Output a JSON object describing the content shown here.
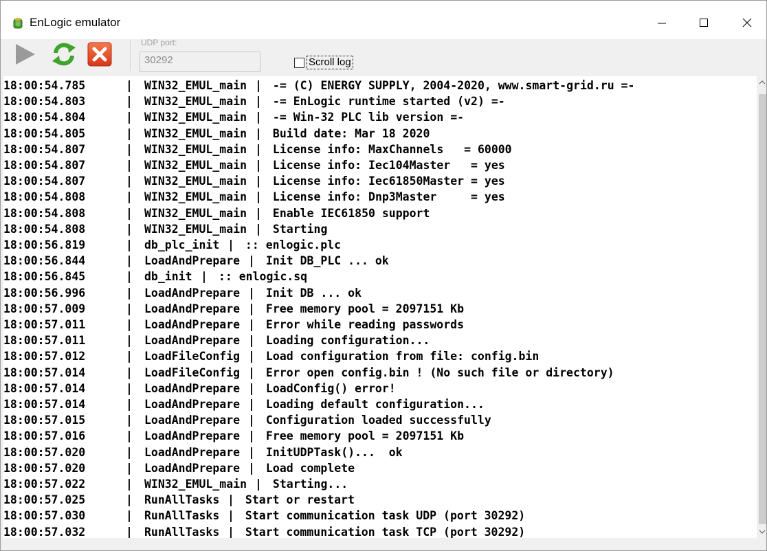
{
  "window": {
    "title": "EnLogic emulator",
    "controls": [
      "minimize",
      "maximize",
      "close"
    ]
  },
  "toolbar": {
    "buttons": [
      {
        "name": "start",
        "icon": "play-icon",
        "color": "#909090"
      },
      {
        "name": "restart",
        "icon": "refresh-icon",
        "color": "#3ea52c"
      },
      {
        "name": "stop",
        "icon": "close-square-icon",
        "color": "#e34b1e"
      }
    ],
    "udp_label": "UDP port:",
    "udp_value": "30292",
    "scroll_log_label": "Scroll log",
    "scroll_log_checked": false
  },
  "log": [
    {
      "time": "18:00:54.785",
      "source": "WIN32_EMUL_main",
      "message": " -= (C) ENERGY SUPPLY, 2004-2020, www.smart-grid.ru =-"
    },
    {
      "time": "18:00:54.803",
      "source": "WIN32_EMUL_main",
      "message": " -= EnLogic runtime started (v2) =-"
    },
    {
      "time": "18:00:54.804",
      "source": "WIN32_EMUL_main",
      "message": " -= Win-32 PLC lib version =-"
    },
    {
      "time": "18:00:54.805",
      "source": "WIN32_EMUL_main",
      "message": " Build date: Mar 18 2020"
    },
    {
      "time": "18:00:54.807",
      "source": "WIN32_EMUL_main",
      "message": " License info: MaxChannels   = 60000"
    },
    {
      "time": "18:00:54.807",
      "source": "WIN32_EMUL_main",
      "message": " License info: Iec104Master   = yes"
    },
    {
      "time": "18:00:54.807",
      "source": "WIN32_EMUL_main",
      "message": " License info: Iec61850Master = yes"
    },
    {
      "time": "18:00:54.808",
      "source": "WIN32_EMUL_main",
      "message": " License info: Dnp3Master     = yes"
    },
    {
      "time": "18:00:54.808",
      "source": "WIN32_EMUL_main",
      "message": " Enable IEC61850 support"
    },
    {
      "time": "18:00:54.808",
      "source": "WIN32_EMUL_main",
      "message": " Starting"
    },
    {
      "time": "18:00:56.819",
      "source": "db_plc_init",
      "message": " :: enlogic.plc"
    },
    {
      "time": "18:00:56.844",
      "source": "LoadAndPrepare",
      "message": " Init DB_PLC ... ok"
    },
    {
      "time": "18:00:56.845",
      "source": "db_init",
      "message": " :: enlogic.sq"
    },
    {
      "time": "18:00:56.996",
      "source": "LoadAndPrepare",
      "message": " Init DB ... ok"
    },
    {
      "time": "18:00:57.009",
      "source": "LoadAndPrepare",
      "message": " Free memory pool = 2097151 Kb"
    },
    {
      "time": "18:00:57.011",
      "source": "LoadAndPrepare",
      "message": " Error while reading passwords"
    },
    {
      "time": "18:00:57.011",
      "source": "LoadAndPrepare",
      "message": " Loading configuration..."
    },
    {
      "time": "18:00:57.012",
      "source": "LoadFileConfig",
      "message": " Load configuration from file: config.bin"
    },
    {
      "time": "18:00:57.014",
      "source": "LoadFileConfig",
      "message": " Error open config.bin ! (No such file or directory)"
    },
    {
      "time": "18:00:57.014",
      "source": "LoadAndPrepare",
      "message": " LoadConfig() error!"
    },
    {
      "time": "18:00:57.014",
      "source": "LoadAndPrepare",
      "message": " Loading default configuration..."
    },
    {
      "time": "18:00:57.015",
      "source": "LoadAndPrepare",
      "message": " Configuration loaded successfully"
    },
    {
      "time": "18:00:57.016",
      "source": "LoadAndPrepare",
      "message": " Free memory pool = 2097151 Kb"
    },
    {
      "time": "18:00:57.020",
      "source": "LoadAndPrepare",
      "message": " InitUDPTask()...  ok"
    },
    {
      "time": "18:00:57.020",
      "source": "LoadAndPrepare",
      "message": " Load complete"
    },
    {
      "time": "18:00:57.022",
      "source": "WIN32_EMUL_main",
      "message": " Starting..."
    },
    {
      "time": "18:00:57.025",
      "source": "RunAllTasks",
      "message": " Start or restart"
    },
    {
      "time": "18:00:57.030",
      "source": "RunAllTasks",
      "message": " Start communication task UDP (port 30292)"
    },
    {
      "time": "18:00:57.032",
      "source": "RunAllTasks",
      "message": " Start communication task TCP (port 30292)"
    }
  ],
  "log_separator": "|",
  "icons": {
    "app": "enlogic-app-icon",
    "scroll_up": "chevron-up-icon",
    "scroll_down": "chevron-down-icon"
  },
  "colors": {
    "titlebar": "#ffffff",
    "window": "#f0f0f0",
    "log_background": "#ffffff",
    "log_text": "#000000"
  }
}
